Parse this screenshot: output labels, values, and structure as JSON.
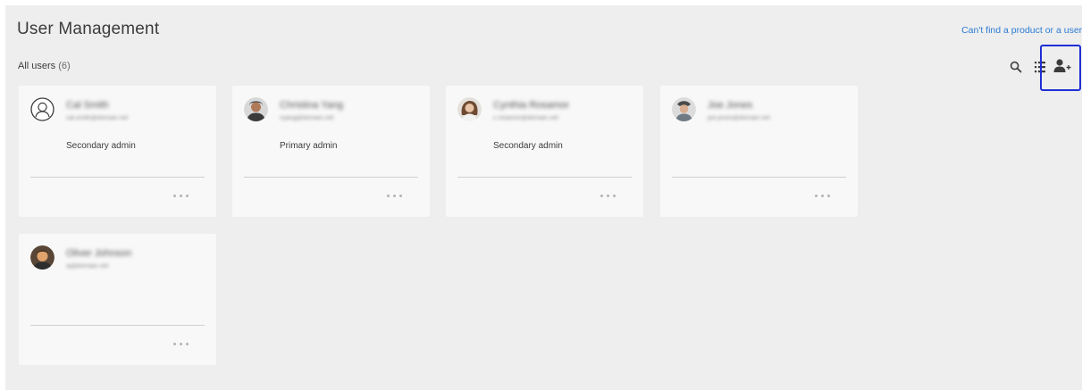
{
  "header": {
    "title": "User Management",
    "help_link": "Can't find a product or a user?"
  },
  "subheader": {
    "label": "All users",
    "count": "(6)"
  },
  "toolbar": {
    "search_icon": "search-icon",
    "view_icon": "list-view-icon",
    "add_icon": "add-user-icon",
    "highlight_color": "#1f2fd6"
  },
  "users": [
    {
      "name": "Cal Smith",
      "email": "cal.smith@domain.net",
      "role": "Secondary admin",
      "avatar": "outline-avatar"
    },
    {
      "name": "Christina Yang",
      "email": "cyang@domain.net",
      "role": "Primary admin",
      "avatar": "photo-avatar"
    },
    {
      "name": "Cynthia Rosamor",
      "email": "c.rosamor@domain.net",
      "role": "Secondary admin",
      "avatar": "photo-avatar"
    },
    {
      "name": "Joe Jones",
      "email": "joe.jones@domain.net",
      "role": "",
      "avatar": "photo-avatar"
    },
    {
      "name": "Oliver Johnson",
      "email": "oj@domain.net",
      "role": "",
      "avatar": "photo-avatar"
    }
  ]
}
